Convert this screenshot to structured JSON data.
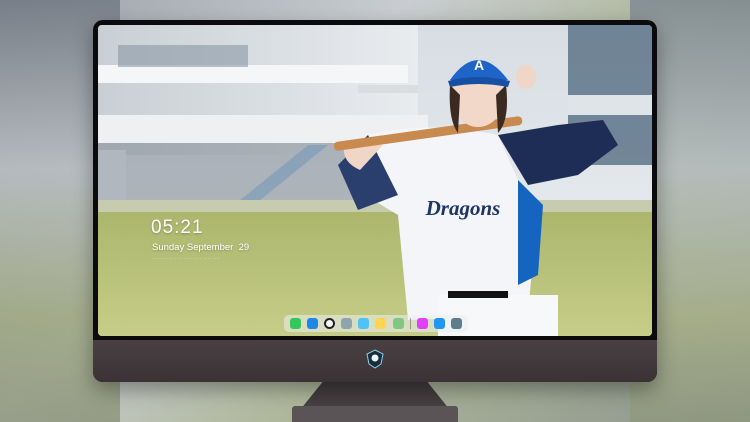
{
  "lockscreen": {
    "time": "05:21",
    "date": "Sunday September  29",
    "subline": "··· ·· ···· ··· ·· ·· · ···· ··· ·· ·· ··· ····"
  },
  "wallpaper": {
    "cap_letter": "A",
    "jersey_text": "Dragons"
  },
  "dock": {
    "icons": [
      {
        "name": "messages-icon",
        "color": "#34c759"
      },
      {
        "name": "finder-icon",
        "color": "#1e88e5"
      },
      {
        "name": "clock-icon",
        "color": "#f5f5f5"
      },
      {
        "name": "preview-icon",
        "color": "#90a4ae"
      },
      {
        "name": "files-icon",
        "color": "#4fc3f7"
      },
      {
        "name": "notes-icon",
        "color": "#ffd54f"
      },
      {
        "name": "photos-icon",
        "color": "#81c784"
      },
      {
        "name": "music-icon",
        "color": "#e040fb"
      },
      {
        "name": "app-store-icon",
        "color": "#2196f3"
      },
      {
        "name": "camera-icon",
        "color": "#607d8b"
      }
    ]
  }
}
